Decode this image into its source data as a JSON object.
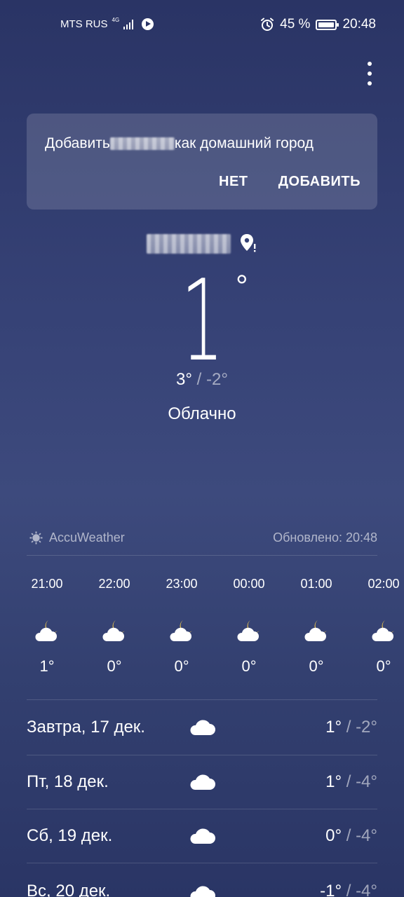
{
  "status_bar": {
    "carrier": "MTS RUS",
    "network": "4G",
    "battery_percent": "45 %",
    "time": "20:48"
  },
  "prompt": {
    "text_prefix": "Добавить",
    "text_suffix": "как домашний город",
    "no_label": "НЕТ",
    "add_label": "ДОБАВИТЬ"
  },
  "current": {
    "temperature": "1",
    "degree": "°",
    "high": "3°",
    "separator": " / ",
    "low": "-2°",
    "condition": "Облачно"
  },
  "source": {
    "provider": "AccuWeather",
    "updated": "Обновлено: 20:48"
  },
  "hourly": [
    {
      "time": "21:00",
      "temp": "1°",
      "icon": "partly-cloudy-night-icon"
    },
    {
      "time": "22:00",
      "temp": "0°",
      "icon": "partly-cloudy-night-icon"
    },
    {
      "time": "23:00",
      "temp": "0°",
      "icon": "partly-cloudy-night-icon"
    },
    {
      "time": "00:00",
      "temp": "0°",
      "icon": "partly-cloudy-night-icon"
    },
    {
      "time": "01:00",
      "temp": "0°",
      "icon": "partly-cloudy-night-icon"
    },
    {
      "time": "02:00",
      "temp": "0°",
      "icon": "partly-cloudy-night-icon"
    }
  ],
  "daily": [
    {
      "label": "Завтра, 17 дек.",
      "high": "1°",
      "separator": " / ",
      "low": "-2°",
      "icon": "cloud-icon"
    },
    {
      "label": "Пт, 18 дек.",
      "high": "1°",
      "separator": " / ",
      "low": "-4°",
      "icon": "cloud-icon"
    },
    {
      "label": "Сб, 19 дек.",
      "high": "0°",
      "separator": " / ",
      "low": "-4°",
      "icon": "cloud-icon"
    },
    {
      "label": "Вс, 20 дек.",
      "high": "-1°",
      "separator": " / ",
      "low": "-4°",
      "icon": "cloud-icon"
    }
  ],
  "colors": {
    "background_top": "#2a3465",
    "background_mid": "#3d4a7d",
    "moon": "#f2c94c",
    "cloud": "#ffffff"
  }
}
